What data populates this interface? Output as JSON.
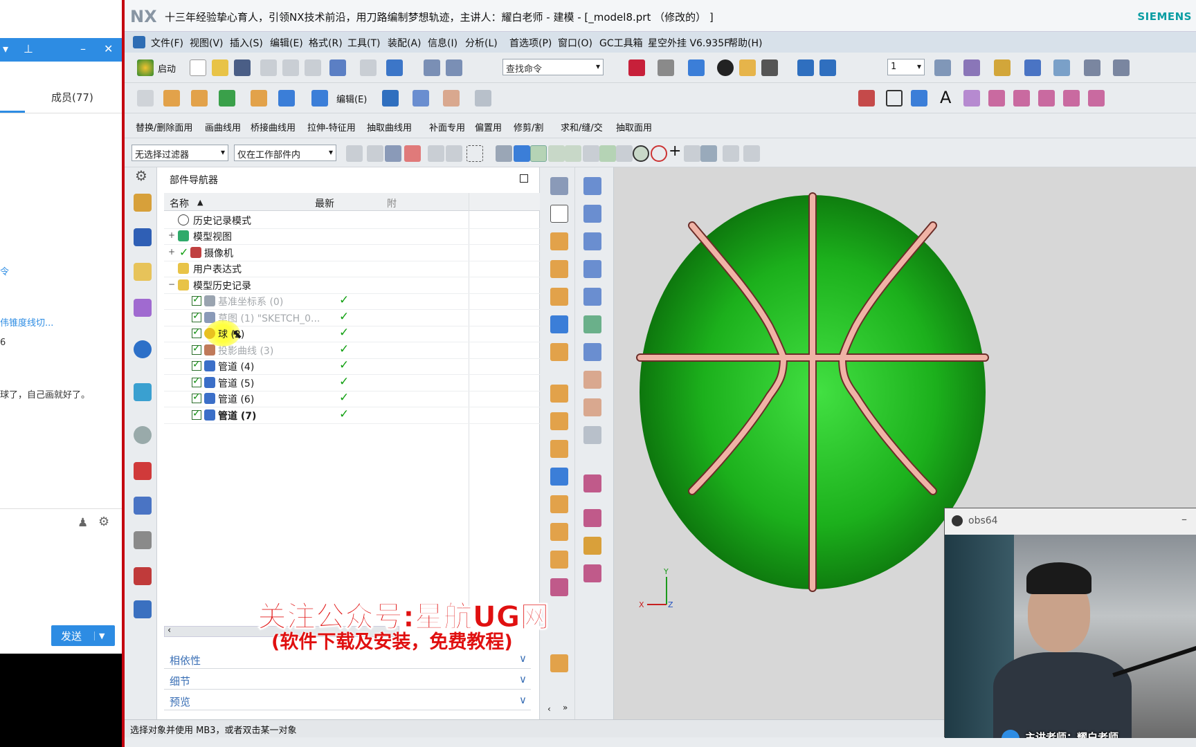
{
  "window": {
    "title": "十三年经验挚心育人，引领NX技术前沿，用刀路编制梦想轨迹，主讲人：耀白老师 - 建模 - [_model8.prt （修改的） ]",
    "logo": "NX",
    "brand": "SIEMENS"
  },
  "menu": [
    "文件(F)",
    "视图(V)",
    "插入(S)",
    "编辑(E)",
    "格式(R)",
    "工具(T)",
    "装配(A)",
    "信息(I)",
    "分析(L)",
    "首选项(P)",
    "窗口(O)",
    "GC工具箱",
    "星空外挂 V6.935F",
    "帮助(H)"
  ],
  "toolbar1": {
    "start_label": "启动",
    "search_placeholder": "查找命令",
    "layer_value": "1"
  },
  "toolbar2": {
    "edit_label": "编辑(E)"
  },
  "toolbar3": [
    "替换/删除面用",
    "画曲线用",
    "桥接曲线用",
    "拉伸-特征用",
    "抽取曲线用",
    "补面专用",
    "偏置用",
    "修剪/割",
    "求和/缝/交",
    "抽取面用"
  ],
  "selection": {
    "filter": "无选择过滤器",
    "scope": "仅在工作部件内"
  },
  "navigator": {
    "title": "部件导航器",
    "col_name": "名称",
    "col_latest": "最新",
    "col_extra": "附",
    "rows": [
      {
        "label": "历史记录模式",
        "level": 0
      },
      {
        "label": "模型视图",
        "level": 0
      },
      {
        "label": "摄像机",
        "level": 0
      },
      {
        "label": "用户表达式",
        "level": 0
      },
      {
        "label": "模型历史记录",
        "level": 0
      },
      {
        "label": "基准坐标系 (0)",
        "level": 1,
        "grey": true
      },
      {
        "label": "草图 (1) \"SKETCH_0...",
        "level": 1,
        "grey": true
      },
      {
        "label": "球 (2)",
        "level": 1
      },
      {
        "label": "投影曲线 (3)",
        "level": 1,
        "grey": true
      },
      {
        "label": "管道 (4)",
        "level": 1
      },
      {
        "label": "管道 (5)",
        "level": 1
      },
      {
        "label": "管道 (6)",
        "level": 1
      },
      {
        "label": "管道 (7)",
        "level": 1
      }
    ],
    "sections": [
      "相依性",
      "细节",
      "预览"
    ]
  },
  "status": "选择对象并使用 MB3，或者双击某一对象",
  "chat": {
    "tab_members": "成员(77)",
    "lines": [
      "令",
      "伟锥度线切...",
      "6",
      "球了，自己画就好了。"
    ],
    "send": "发送"
  },
  "watermark": {
    "line1": "关注公众号:星航UG网",
    "line2": "(软件下载及安装，免费教程)"
  },
  "obs": {
    "title": "obs64",
    "caption": "主讲老师：耀白老师"
  },
  "triad": {
    "x": "X",
    "y": "Y",
    "z": "Z"
  },
  "colors": {
    "ball": "#1fae1f",
    "seam": "#e8a39a",
    "viewport": "#d7d7d7",
    "check": "#12a012"
  }
}
